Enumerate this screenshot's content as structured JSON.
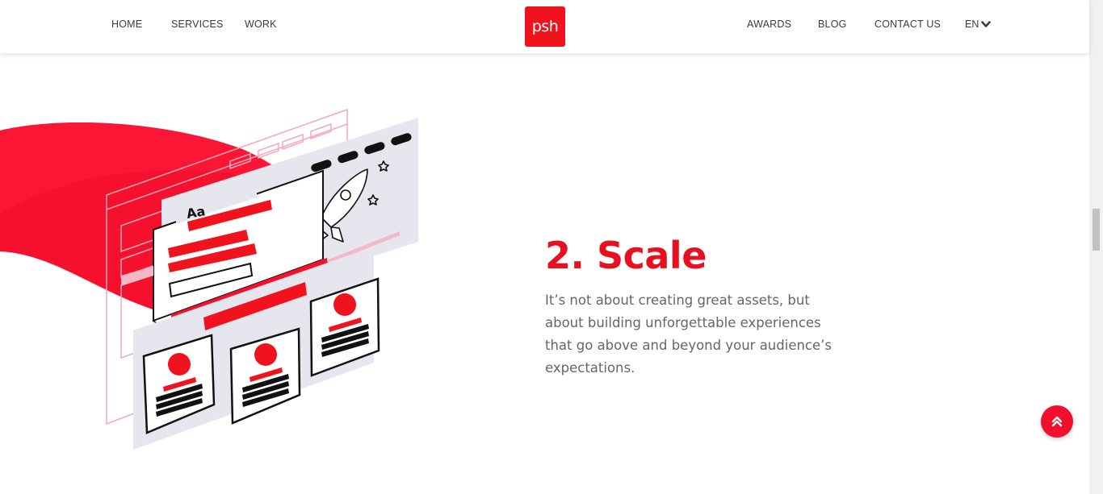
{
  "header": {
    "nav_left": [
      {
        "label": "HOME"
      },
      {
        "label": "SERVICES"
      },
      {
        "label": "WORK"
      }
    ],
    "nav_right": [
      {
        "label": "AWARDS"
      },
      {
        "label": "BLOG"
      },
      {
        "label": "CONTACT US"
      }
    ],
    "logo_text": "psh",
    "language": "EN"
  },
  "main": {
    "heading": "2. Scale",
    "body": "It’s not about creating great assets, but about building unforgettable experiences that go above and beyond your audience’s expectations.",
    "illustration": {
      "font_sample": "Aa"
    }
  },
  "colors": {
    "brand_red": "#e8101f",
    "logo_bg": "#f0121d",
    "button_red": "#f20f2e",
    "text_gray": "#666666",
    "nav_text": "#3a3a3a"
  },
  "icons": {
    "language_dropdown": "chevron-down-icon",
    "back_to_top": "double-chevron-up-icon"
  }
}
